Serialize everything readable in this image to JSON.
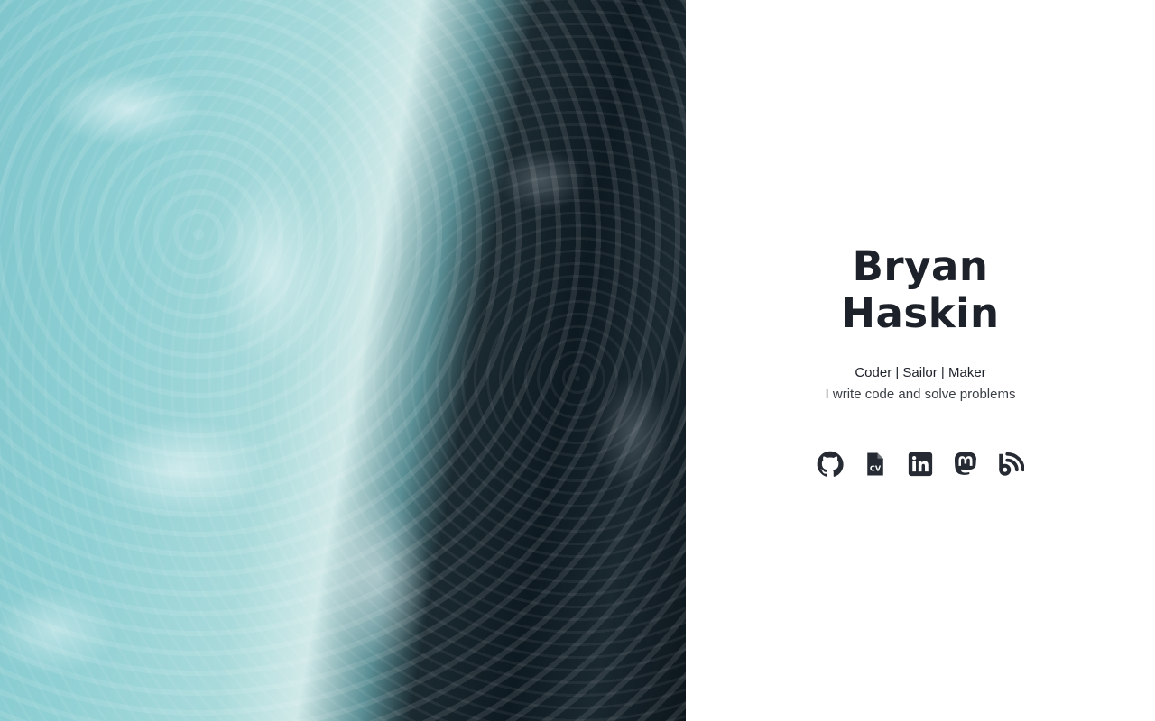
{
  "hero": {
    "image": "aerial-ocean-waves"
  },
  "profile": {
    "name_first": "Bryan",
    "name_last": "Haskin",
    "tagline": "Coder | Sailor | Maker",
    "bio": "I write code and solve problems"
  },
  "social": [
    {
      "icon": "github-icon",
      "label": "GitHub"
    },
    {
      "icon": "cv-icon",
      "label": "CV"
    },
    {
      "icon": "linkedin-icon",
      "label": "LinkedIn"
    },
    {
      "icon": "mastodon-icon",
      "label": "Mastodon"
    },
    {
      "icon": "blog-icon",
      "label": "Blog"
    }
  ],
  "colors": {
    "text": "#1d2129",
    "icon": "#262b33",
    "background": "#ffffff"
  }
}
